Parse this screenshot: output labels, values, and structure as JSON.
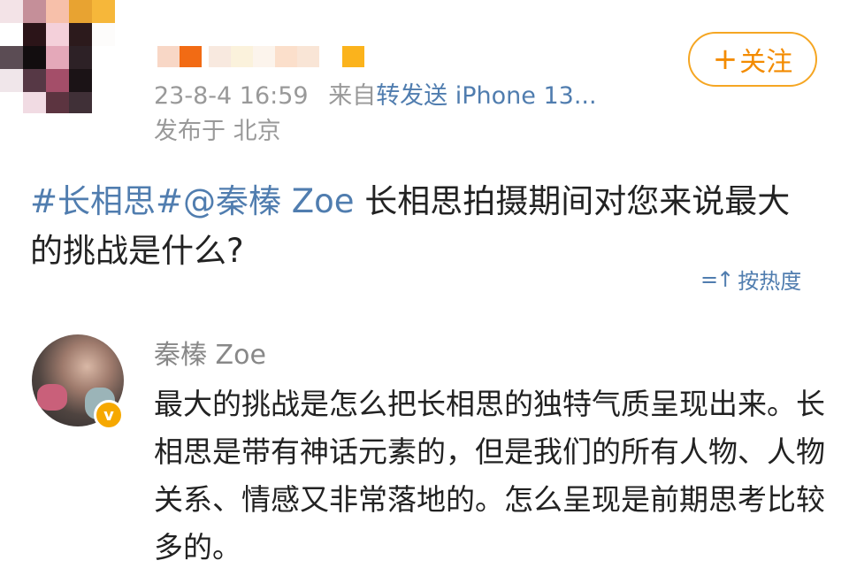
{
  "header": {
    "follow_button": {
      "icon": "plus-icon",
      "plus": "+",
      "label": "关注"
    },
    "meta": {
      "timestamp": "23-8-4 16:59",
      "source_prefix": "来自",
      "source_link": "转发送 iPhone 13..."
    },
    "location": "发布于 北京"
  },
  "post": {
    "topic_tag": "#长相思#",
    "mention": "@秦榛 Zoe",
    "question_text": " 长相思拍摄期间对您来说最大的挑战是什么?"
  },
  "sort": {
    "icon": "sort-icon",
    "icon_glyph": "=↑",
    "label": "按热度"
  },
  "answer": {
    "author": "秦榛 Zoe",
    "verified_icon": "verified-badge-icon",
    "verified_glyph": "v",
    "text": "最大的挑战是怎么把长相思的独特气质呈现出来。长相思是带有神话元素的，但是我们的所有人物、人物关系、情感又非常落地的。怎么呈现是前期思考比较多的。"
  },
  "colors": {
    "link": "#507daf",
    "accent_orange": "#f5a623",
    "meta_gray": "#999999"
  }
}
